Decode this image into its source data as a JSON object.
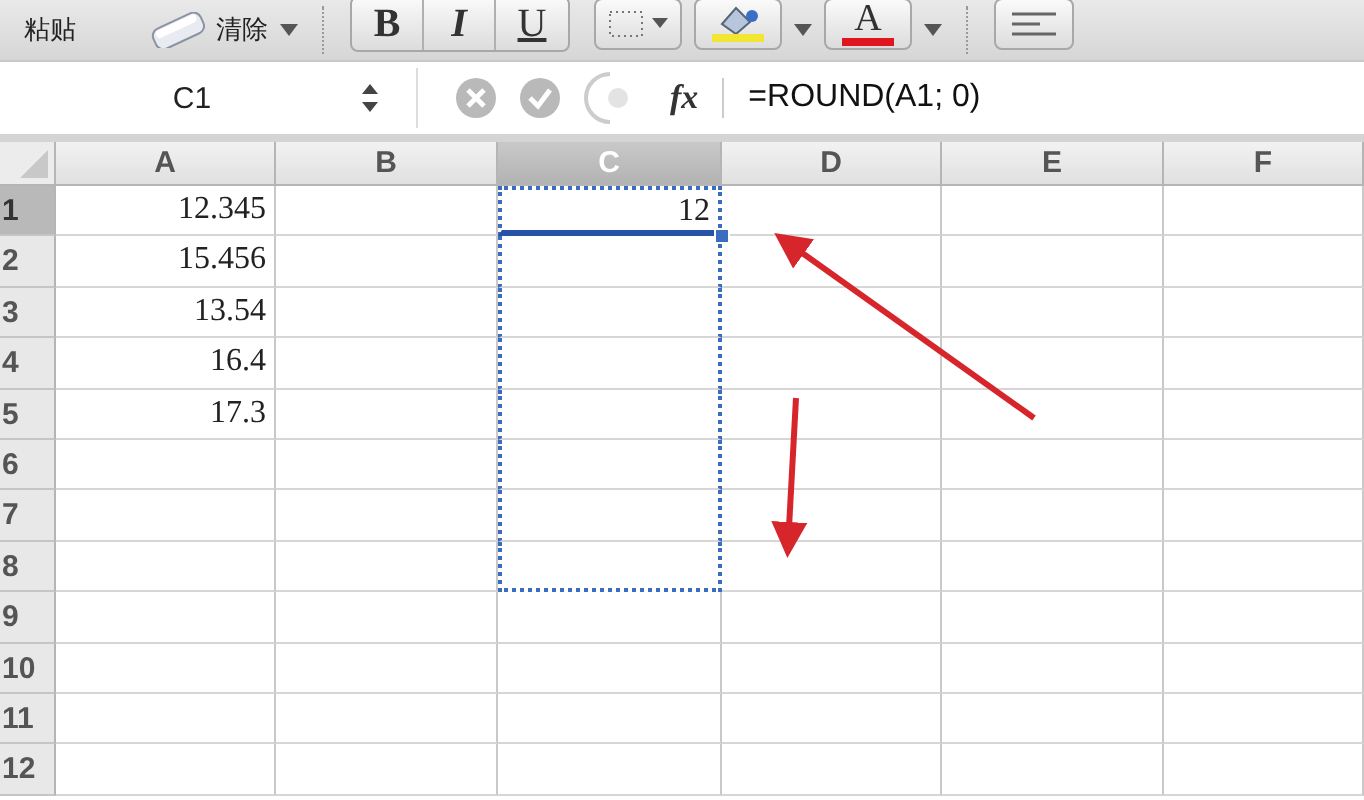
{
  "toolbar": {
    "paste_label": "粘贴",
    "clear_label": "清除",
    "format_buttons": [
      "B",
      "I",
      "U"
    ],
    "font_color_label": "A"
  },
  "formula_bar": {
    "name_box": "C1",
    "function_symbol": "fx",
    "formula": "=ROUND(A1; 0)"
  },
  "sheet": {
    "columns": [
      {
        "label": "A",
        "selected": false
      },
      {
        "label": "B",
        "selected": false
      },
      {
        "label": "C",
        "selected": true
      },
      {
        "label": "D",
        "selected": false
      },
      {
        "label": "E",
        "selected": false
      },
      {
        "label": "F",
        "selected": false
      }
    ],
    "rows": [
      {
        "header": "1",
        "selected": true,
        "active": true,
        "in_marquee": true,
        "cells": [
          "12.345",
          "",
          "12",
          "",
          "",
          ""
        ]
      },
      {
        "header": "2",
        "selected": false,
        "active": false,
        "in_marquee": true,
        "cells": [
          "15.456",
          "",
          "",
          "",
          "",
          ""
        ]
      },
      {
        "header": "3",
        "selected": false,
        "active": false,
        "in_marquee": true,
        "cells": [
          "13.54",
          "",
          "",
          "",
          "",
          ""
        ]
      },
      {
        "header": "4",
        "selected": false,
        "active": false,
        "in_marquee": true,
        "cells": [
          "16.4",
          "",
          "",
          "",
          "",
          ""
        ]
      },
      {
        "header": "5",
        "selected": false,
        "active": false,
        "in_marquee": true,
        "cells": [
          "17.3",
          "",
          "",
          "",
          "",
          ""
        ]
      },
      {
        "header": "6",
        "selected": false,
        "active": false,
        "in_marquee": true,
        "cells": [
          "",
          "",
          "",
          "",
          "",
          ""
        ]
      },
      {
        "header": "7",
        "selected": false,
        "active": false,
        "in_marquee": true,
        "cells": [
          "",
          "",
          "",
          "",
          "",
          ""
        ]
      },
      {
        "header": "8",
        "selected": false,
        "active": false,
        "in_marquee": true,
        "cells": [
          "",
          "",
          "",
          "",
          "",
          ""
        ]
      },
      {
        "header": "9",
        "selected": false,
        "active": false,
        "in_marquee": false,
        "cells": [
          "",
          "",
          "",
          "",
          "",
          ""
        ]
      },
      {
        "header": "10",
        "selected": false,
        "active": false,
        "in_marquee": false,
        "cells": [
          "",
          "",
          "",
          "",
          "",
          ""
        ]
      },
      {
        "header": "11",
        "selected": false,
        "active": false,
        "in_marquee": false,
        "cells": [
          "",
          "",
          "",
          "",
          "",
          ""
        ]
      },
      {
        "header": "12",
        "selected": false,
        "active": false,
        "in_marquee": false,
        "cells": [
          "",
          "",
          "",
          "",
          "",
          ""
        ]
      }
    ]
  }
}
